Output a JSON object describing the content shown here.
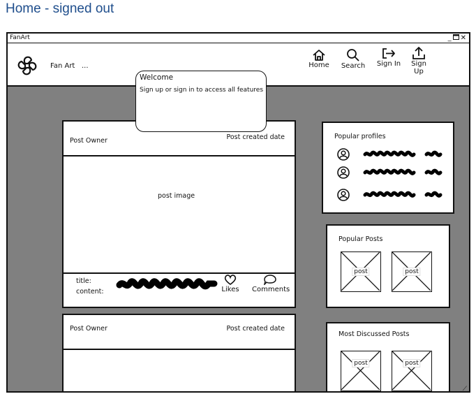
{
  "page_title": "Home - signed out",
  "window": {
    "title": "FanArt",
    "controls": [
      "minimize",
      "maximize",
      "close"
    ]
  },
  "navbar": {
    "brand": "Fan Art",
    "more": "...",
    "items": [
      {
        "label": "Home",
        "icon": "home-icon"
      },
      {
        "label": "Search",
        "icon": "search-icon"
      },
      {
        "label": "Sign In",
        "icon": "sign-in-icon"
      },
      {
        "label": "Sign Up",
        "icon": "upload-icon"
      }
    ]
  },
  "welcome_popup": {
    "title": "Welcome",
    "message": "Sign up or sign in to access all features"
  },
  "posts": [
    {
      "owner": "Post Owner",
      "date": "Post created date",
      "image": "post image",
      "title_label": "title:",
      "content_label": "content:",
      "likes": "Likes",
      "comments": "Comments"
    },
    {
      "owner": "Post Owner",
      "date": "Post created date"
    }
  ],
  "popular_profiles": {
    "title": "Popular profiles",
    "count": 3
  },
  "popular_posts": {
    "title": "Popular Posts",
    "items": [
      "post",
      "post"
    ]
  },
  "most_discussed": {
    "title": "Most Discussed Posts",
    "items": [
      "post",
      "post"
    ]
  }
}
